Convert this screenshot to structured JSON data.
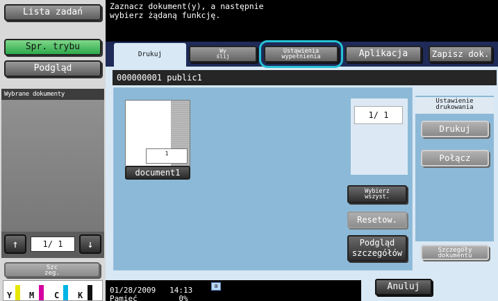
{
  "left_column": {
    "job_list_button": "Lista zadań",
    "mode_check_button": "Spr. trybu",
    "preview_button": "Podgląd",
    "selected_docs_header": "Wybrane dokumenty",
    "pager": {
      "up": "↑",
      "page": "1/  1",
      "down": "↓"
    },
    "details_button_line1": "Szc",
    "details_button_line2": "zeg.",
    "toner": [
      {
        "label": "Y",
        "color": "#e6e600"
      },
      {
        "label": "M",
        "color": "#d400a0"
      },
      {
        "label": "C",
        "color": "#00b4e6"
      },
      {
        "label": "K",
        "color": "#111111"
      }
    ]
  },
  "message": "Zaznacz dokument(y), a następnie\nwybierz żądaną funkcję.",
  "tabs": [
    {
      "label": "Drukuj",
      "active": true
    },
    {
      "label_line1": "Wy",
      "label_line2": "ślij"
    },
    {
      "label_line1": "Ustawienia",
      "label_line2": "wypełnienia",
      "highlighted": true
    },
    {
      "label": "Aplikacja"
    },
    {
      "label": "Zapisz dok."
    }
  ],
  "box_bar": "000000001  public1",
  "document": {
    "thumb_page": "1",
    "name": "document1"
  },
  "scroll_counter": "1/  1",
  "buttons": {
    "select_all_line1": "Wybierz",
    "select_all_line2": "wszyst.",
    "reset": "Resetow.",
    "detail_preview_line1": "Podgląd",
    "detail_preview_line2": "szczegółów"
  },
  "right_panel": {
    "header_line1": "Ustawienie",
    "header_line2": "drukowania",
    "print_button": "Drukuj",
    "combine_button": "Połącz",
    "doc_details_line1": "Szczegóły",
    "doc_details_line2": "dokumentu"
  },
  "status": {
    "datetime": "01/28/2009   14:13",
    "memory": "Pamięć         0%"
  },
  "cancel_button": "Anuluj"
}
